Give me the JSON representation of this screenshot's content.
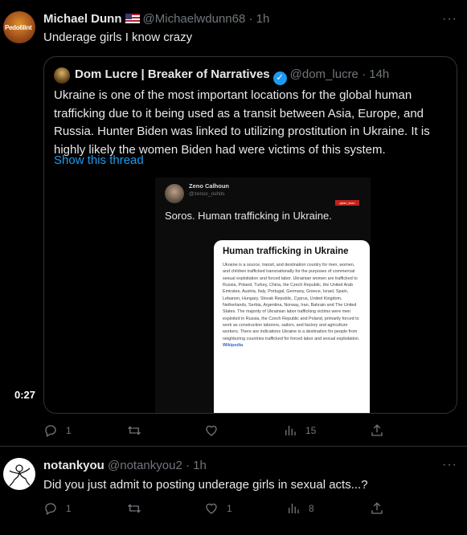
{
  "tweet1": {
    "author_name": "Michael Dunn",
    "author_handle": "@Michaelwdunn68 · 1h",
    "avatar_text": "Pedo6lint",
    "text": "Underage girls I know crazy",
    "quote": {
      "author_name": "Dom Lucre | Breaker of Narratives",
      "author_handle": "@dom_lucre · 14h",
      "text": "Ukraine is one of the most important locations for the global human trafficking due to it being used as a transit between Asia, Europe, and Russia. Hunter Biden was linked to utilizing prostitution in Ukraine. It is highly likely the women Biden had were victims of this system.",
      "show_thread": "Show this thread",
      "video": {
        "duration": "0:27",
        "inner_name": "Zeno Calhoun",
        "inner_handle": "@zenoc_oshits",
        "inner_tag": "gban_korn",
        "inner_text": "Soros. Human trafficking in Ukraine.",
        "card_title": "Human trafficking in Ukraine",
        "card_body": "Ukraine is a source, transit, and destination country for men, women, and children trafficked transnationally for the purposes of commercial sexual exploitation and forced labor. Ukrainian women are trafficked to Russia, Poland, Turkey, China, the Czech Republic, the United Arab Emirates, Austria, Italy, Portugal, Germany, Greece, Israel, Spain, Lebanon, Hungary, Slovak Republic, Cyprus, United Kingdom, Netherlands, Serbia, Argentina, Norway, Iran, Bahrain and The United States. The majority of Ukrainian labor trafficking victims were men exploited in Russia, the Czech Republic and Poland, primarily forced to work as construction laborers, sailors, and factory and agriculture workers. There are indications Ukraine is a destination for people from neighboring countries trafficked for forced labor and sexual exploitation.",
        "card_source": "Wikipedia"
      }
    },
    "actions": {
      "replies": "1",
      "retweets": "",
      "likes": "",
      "views": "15"
    }
  },
  "tweet2": {
    "author_name": "notankyou",
    "author_handle": "@notankyou2 · 1h",
    "text": "Did you just admit to posting underage girls in sexual acts...?",
    "actions": {
      "replies": "1",
      "retweets": "",
      "likes": "1",
      "views": "8"
    }
  },
  "icons": [
    "more-icon",
    "flag-us-icon",
    "verified-badge-icon",
    "reply-icon",
    "retweet-icon",
    "like-icon",
    "views-icon",
    "share-icon"
  ]
}
